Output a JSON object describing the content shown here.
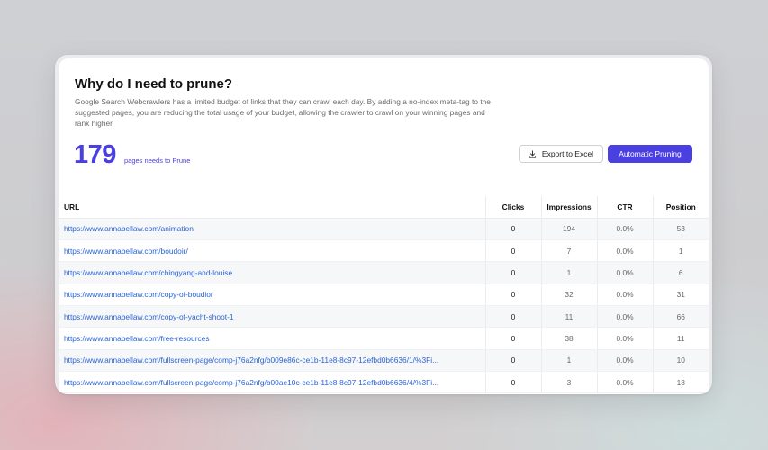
{
  "header": {
    "title": "Why do I need to prune?",
    "description": "Google Search Webcrawlers has a limited budget of links that they can crawl each day. By adding a no-index meta-tag to the suggested pages, you are reducing the total usage of your budget, allowing the crawler to crawl on your winning pages and rank higher.",
    "count": "179",
    "count_label": "pages needs to Prune",
    "export_label": "Export to Excel",
    "auto_label": "Automatic Pruning"
  },
  "colors": {
    "accent": "#4a3fe0",
    "link": "#2a63d6"
  },
  "table": {
    "columns": [
      "URL",
      "Clicks",
      "Impressions",
      "CTR",
      "Position"
    ],
    "rows": [
      {
        "url": "https://www.annabellaw.com/animation",
        "clicks": "0",
        "impressions": "194",
        "ctr": "0.0%",
        "position": "53"
      },
      {
        "url": "https://www.annabellaw.com/boudoir/",
        "clicks": "0",
        "impressions": "7",
        "ctr": "0.0%",
        "position": "1"
      },
      {
        "url": "https://www.annabellaw.com/chingyang-and-louise",
        "clicks": "0",
        "impressions": "1",
        "ctr": "0.0%",
        "position": "6"
      },
      {
        "url": "https://www.annabellaw.com/copy-of-boudior",
        "clicks": "0",
        "impressions": "32",
        "ctr": "0.0%",
        "position": "31"
      },
      {
        "url": "https://www.annabellaw.com/copy-of-yacht-shoot-1",
        "clicks": "0",
        "impressions": "11",
        "ctr": "0.0%",
        "position": "66"
      },
      {
        "url": "https://www.annabellaw.com/free-resources",
        "clicks": "0",
        "impressions": "38",
        "ctr": "0.0%",
        "position": "11"
      },
      {
        "url": "https://www.annabellaw.com/fullscreen-page/comp-j76a2nfg/b009e86c-ce1b-11e8-8c97-12efbd0b6636/1/%3Fi...",
        "clicks": "0",
        "impressions": "1",
        "ctr": "0.0%",
        "position": "10"
      },
      {
        "url": "https://www.annabellaw.com/fullscreen-page/comp-j76a2nfg/b00ae10c-ce1b-11e8-8c97-12efbd0b6636/4/%3Fi...",
        "clicks": "0",
        "impressions": "3",
        "ctr": "0.0%",
        "position": "18"
      }
    ]
  }
}
